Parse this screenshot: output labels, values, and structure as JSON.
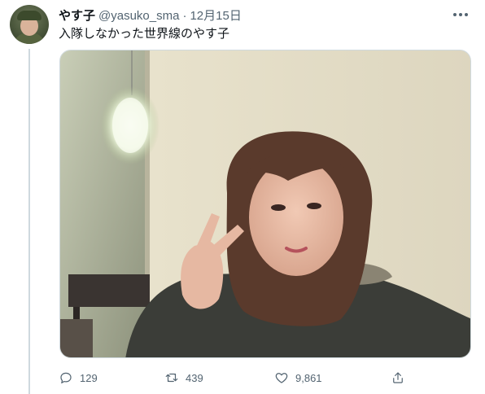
{
  "tweet": {
    "display_name": "やす子",
    "handle": "@yasuko_sma",
    "separator": "·",
    "date": "12月15日",
    "text": "入隊しなかった世界線のやす子",
    "media": {
      "alt": ""
    }
  },
  "actions": {
    "reply_count": "129",
    "retweet_count": "439",
    "like_count": "9,861"
  },
  "icons": {
    "reply": "comment-icon",
    "retweet": "retweet-icon",
    "like": "heart-icon",
    "share": "share-icon",
    "more": "more-dots-icon"
  },
  "colors": {
    "text_primary": "#0f1419",
    "text_secondary": "#536471",
    "divider": "#cfd9de"
  }
}
